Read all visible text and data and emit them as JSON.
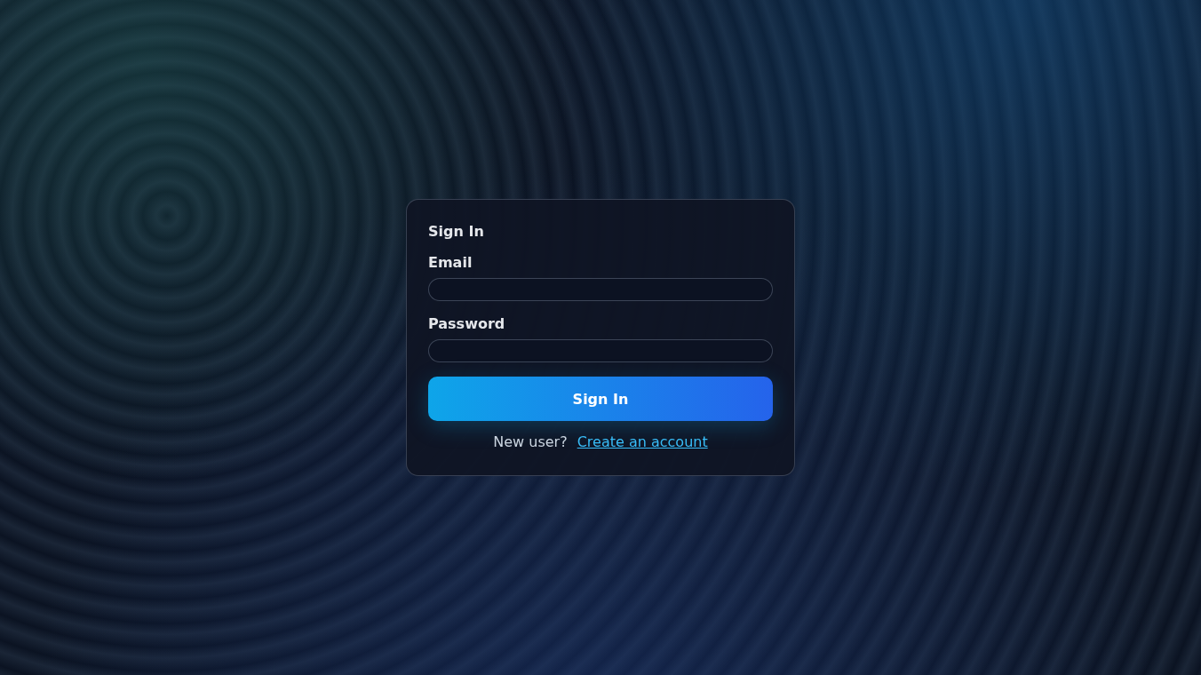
{
  "form": {
    "title": "Sign In",
    "fields": [
      {
        "label": "Email"
      },
      {
        "label": "Password"
      }
    ],
    "submit": "Sign In",
    "footer": {
      "prompt": "New user?",
      "link": "Create an account"
    }
  }
}
